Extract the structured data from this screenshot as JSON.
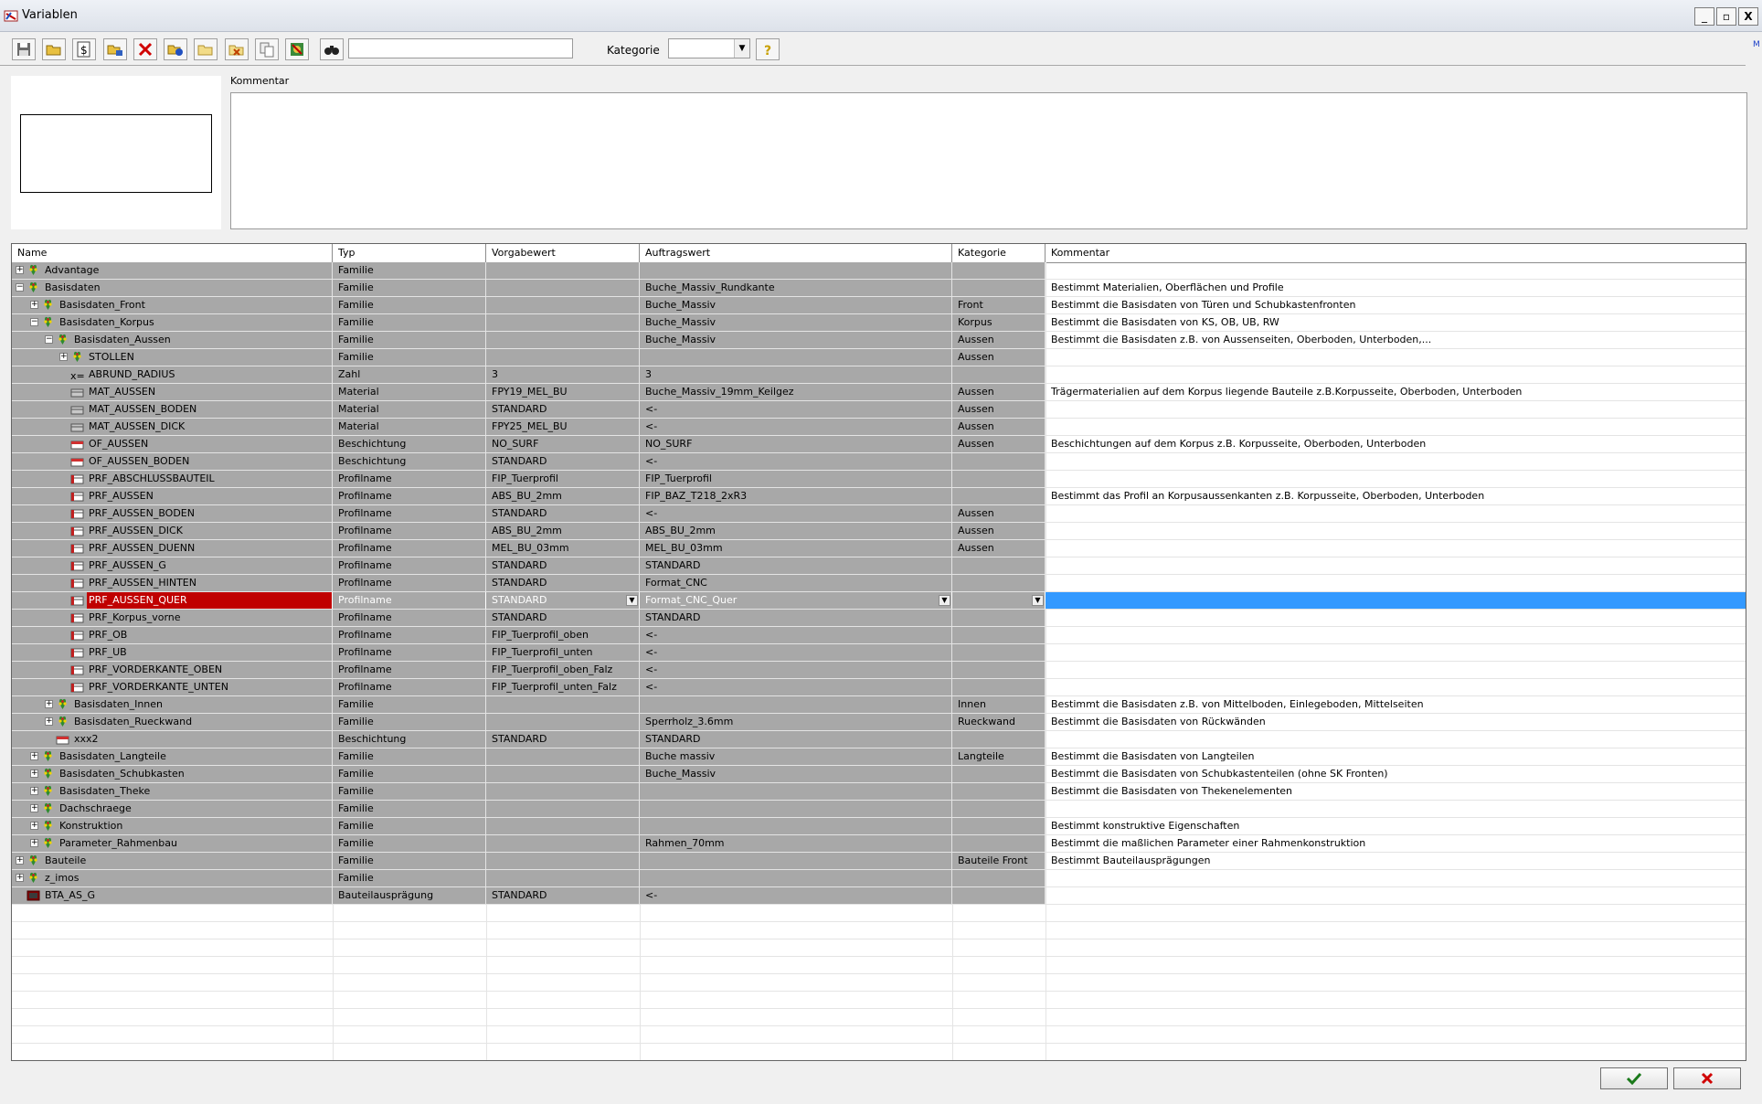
{
  "window": {
    "title": "Variablen",
    "minimize": "_",
    "maximize": "▫",
    "close": "X"
  },
  "toolbar": {
    "buttons": [
      "save-icon",
      "open-folder-icon",
      "dollar-icon",
      "tree-edit-icon",
      "delete-icon",
      "add-variable-icon",
      "folder-icon",
      "cut-icon",
      "copy-icon",
      "export-icon",
      "binoculars-icon"
    ],
    "search_value": "",
    "kategorie_label": "Kategorie",
    "kategorie_value": "",
    "help_icon": "help-icon",
    "edge_link": "M"
  },
  "top_panel": {
    "comment_label": "Kommentar",
    "comment_value": ""
  },
  "table": {
    "columns": [
      "Name",
      "Typ",
      "Vorgabewert",
      "Auftragswert",
      "Kategorie",
      "Kommentar"
    ],
    "rows": [
      {
        "level": 0,
        "exp": "+",
        "icon": "family",
        "name": "Advantage",
        "typ": "Familie",
        "vorgabe": "",
        "auftrag": "",
        "kat": "",
        "komm": ""
      },
      {
        "level": 0,
        "exp": "-",
        "icon": "family",
        "name": "Basisdaten",
        "typ": "Familie",
        "vorgabe": "",
        "auftrag": "Buche_Massiv_Rundkante",
        "kat": "",
        "komm": "Bestimmt Materialien, Oberflächen und Profile"
      },
      {
        "level": 1,
        "exp": "+",
        "icon": "family",
        "name": "Basisdaten_Front",
        "typ": "Familie",
        "vorgabe": "",
        "auftrag": "Buche_Massiv",
        "kat": "Front",
        "komm": "Bestimmt die Basisdaten von Türen und Schubkastenfronten"
      },
      {
        "level": 1,
        "exp": "-",
        "icon": "family",
        "name": "Basisdaten_Korpus",
        "typ": "Familie",
        "vorgabe": "",
        "auftrag": "Buche_Massiv",
        "kat": "Korpus",
        "komm": "Bestimmt die Basisdaten von KS, OB, UB, RW"
      },
      {
        "level": 2,
        "exp": "-",
        "icon": "family",
        "name": "Basisdaten_Aussen",
        "typ": "Familie",
        "vorgabe": "",
        "auftrag": "Buche_Massiv",
        "kat": "Aussen",
        "komm": "Bestimmt die Basisdaten z.B. von Aussenseiten, Oberboden, Unterboden,..."
      },
      {
        "level": 3,
        "exp": "+",
        "icon": "family",
        "name": "STOLLEN",
        "typ": "Familie",
        "vorgabe": "",
        "auftrag": "",
        "kat": "Aussen",
        "komm": ""
      },
      {
        "level": 3,
        "exp": "",
        "icon": "number",
        "name": "ABRUND_RADIUS",
        "typ": "Zahl",
        "vorgabe": "3",
        "auftrag": "3",
        "kat": "",
        "komm": ""
      },
      {
        "level": 3,
        "exp": "",
        "icon": "material",
        "name": "MAT_AUSSEN",
        "typ": "Material",
        "vorgabe": "FPY19_MEL_BU",
        "auftrag": "Buche_Massiv_19mm_Keilgez",
        "kat": "Aussen",
        "komm": "Trägermaterialien auf dem Korpus liegende Bauteile z.B.Korpusseite, Oberboden, Unterboden"
      },
      {
        "level": 3,
        "exp": "",
        "icon": "material",
        "name": "MAT_AUSSEN_BODEN",
        "typ": "Material",
        "vorgabe": "STANDARD",
        "auftrag": "<-",
        "kat": "Aussen",
        "komm": ""
      },
      {
        "level": 3,
        "exp": "",
        "icon": "material",
        "name": "MAT_AUSSEN_DICK",
        "typ": "Material",
        "vorgabe": "FPY25_MEL_BU",
        "auftrag": "<-",
        "kat": "Aussen",
        "komm": ""
      },
      {
        "level": 3,
        "exp": "",
        "icon": "coating",
        "name": "OF_AUSSEN",
        "typ": "Beschichtung",
        "vorgabe": "NO_SURF",
        "auftrag": "NO_SURF",
        "kat": "Aussen",
        "komm": "Beschichtungen auf dem Korpus z.B. Korpusseite, Oberboden, Unterboden"
      },
      {
        "level": 3,
        "exp": "",
        "icon": "coating",
        "name": "OF_AUSSEN_BODEN",
        "typ": "Beschichtung",
        "vorgabe": "STANDARD",
        "auftrag": "<-",
        "kat": "",
        "komm": ""
      },
      {
        "level": 3,
        "exp": "",
        "icon": "profile",
        "name": "PRF_ABSCHLUSSBAUTEIL",
        "typ": "Profilname",
        "vorgabe": "FIP_Tuerprofil",
        "auftrag": "FIP_Tuerprofil",
        "kat": "",
        "komm": ""
      },
      {
        "level": 3,
        "exp": "",
        "icon": "profile",
        "name": "PRF_AUSSEN",
        "typ": "Profilname",
        "vorgabe": "ABS_BU_2mm",
        "auftrag": "FIP_BAZ_T218_2xR3",
        "kat": "",
        "komm": "Bestimmt das Profil an Korpusaussenkanten z.B. Korpusseite, Oberboden, Unterboden"
      },
      {
        "level": 3,
        "exp": "",
        "icon": "profile",
        "name": "PRF_AUSSEN_BODEN",
        "typ": "Profilname",
        "vorgabe": "STANDARD",
        "auftrag": "<-",
        "kat": "Aussen",
        "komm": ""
      },
      {
        "level": 3,
        "exp": "",
        "icon": "profile",
        "name": "PRF_AUSSEN_DICK",
        "typ": "Profilname",
        "vorgabe": "ABS_BU_2mm",
        "auftrag": "ABS_BU_2mm",
        "kat": "Aussen",
        "komm": ""
      },
      {
        "level": 3,
        "exp": "",
        "icon": "profile",
        "name": "PRF_AUSSEN_DUENN",
        "typ": "Profilname",
        "vorgabe": "MEL_BU_03mm",
        "auftrag": "MEL_BU_03mm",
        "kat": "Aussen",
        "komm": ""
      },
      {
        "level": 3,
        "exp": "",
        "icon": "profile",
        "name": "PRF_AUSSEN_G",
        "typ": "Profilname",
        "vorgabe": "STANDARD",
        "auftrag": "STANDARD",
        "kat": "",
        "komm": ""
      },
      {
        "level": 3,
        "exp": "",
        "icon": "profile",
        "name": "PRF_AUSSEN_HINTEN",
        "typ": "Profilname",
        "vorgabe": "STANDARD",
        "auftrag": "Format_CNC",
        "kat": "",
        "komm": ""
      },
      {
        "level": 3,
        "exp": "",
        "icon": "profile",
        "name": "PRF_AUSSEN_QUER",
        "typ": "Profilname",
        "vorgabe": "STANDARD",
        "auftrag": "Format_CNC_Quer",
        "kat": "",
        "komm": "",
        "selected": true
      },
      {
        "level": 3,
        "exp": "",
        "icon": "profile",
        "name": "PRF_Korpus_vorne",
        "typ": "Profilname",
        "vorgabe": "STANDARD",
        "auftrag": "STANDARD",
        "kat": "",
        "komm": ""
      },
      {
        "level": 3,
        "exp": "",
        "icon": "profile",
        "name": "PRF_OB",
        "typ": "Profilname",
        "vorgabe": "FIP_Tuerprofil_oben",
        "auftrag": "<-",
        "kat": "",
        "komm": ""
      },
      {
        "level": 3,
        "exp": "",
        "icon": "profile",
        "name": "PRF_UB",
        "typ": "Profilname",
        "vorgabe": "FIP_Tuerprofil_unten",
        "auftrag": "<-",
        "kat": "",
        "komm": ""
      },
      {
        "level": 3,
        "exp": "",
        "icon": "profile",
        "name": "PRF_VORDERKANTE_OBEN",
        "typ": "Profilname",
        "vorgabe": "FIP_Tuerprofil_oben_Falz",
        "auftrag": "<-",
        "kat": "",
        "komm": ""
      },
      {
        "level": 3,
        "exp": "",
        "icon": "profile",
        "name": "PRF_VORDERKANTE_UNTEN",
        "typ": "Profilname",
        "vorgabe": "FIP_Tuerprofil_unten_Falz",
        "auftrag": "<-",
        "kat": "",
        "komm": ""
      },
      {
        "level": 2,
        "exp": "+",
        "icon": "family",
        "name": "Basisdaten_Innen",
        "typ": "Familie",
        "vorgabe": "",
        "auftrag": "",
        "kat": "Innen",
        "komm": "Bestimmt die Basisdaten z.B. von Mittelboden, Einlegeboden, Mittelseiten"
      },
      {
        "level": 2,
        "exp": "+",
        "icon": "family",
        "name": "Basisdaten_Rueckwand",
        "typ": "Familie",
        "vorgabe": "",
        "auftrag": "Sperrholz_3.6mm",
        "kat": "Rueckwand",
        "komm": "Bestimmt die Basisdaten von Rückwänden"
      },
      {
        "level": 2,
        "exp": "",
        "icon": "coating",
        "name": "xxx2",
        "typ": "Beschichtung",
        "vorgabe": "STANDARD",
        "auftrag": "STANDARD",
        "kat": "",
        "komm": ""
      },
      {
        "level": 1,
        "exp": "+",
        "icon": "family",
        "name": "Basisdaten_Langteile",
        "typ": "Familie",
        "vorgabe": "",
        "auftrag": "Buche massiv",
        "kat": "Langteile",
        "komm": "Bestimmt die Basisdaten von Langteilen"
      },
      {
        "level": 1,
        "exp": "+",
        "icon": "family",
        "name": "Basisdaten_Schubkasten",
        "typ": "Familie",
        "vorgabe": "",
        "auftrag": "Buche_Massiv",
        "kat": "",
        "komm": "Bestimmt die Basisdaten von Schubkastenteilen (ohne SK Fronten)"
      },
      {
        "level": 1,
        "exp": "+",
        "icon": "family",
        "name": "Basisdaten_Theke",
        "typ": "Familie",
        "vorgabe": "",
        "auftrag": "",
        "kat": "",
        "komm": "Bestimmt die Basisdaten von Thekenelementen"
      },
      {
        "level": 1,
        "exp": "+",
        "icon": "family",
        "name": "Dachschraege",
        "typ": "Familie",
        "vorgabe": "",
        "auftrag": "",
        "kat": "",
        "komm": ""
      },
      {
        "level": 1,
        "exp": "+",
        "icon": "family",
        "name": "Konstruktion",
        "typ": "Familie",
        "vorgabe": "",
        "auftrag": "",
        "kat": "",
        "komm": "Bestimmt konstruktive Eigenschaften"
      },
      {
        "level": 1,
        "exp": "+",
        "icon": "family",
        "name": "Parameter_Rahmenbau",
        "typ": "Familie",
        "vorgabe": "",
        "auftrag": "Rahmen_70mm",
        "kat": "",
        "komm": "Bestimmt die maßlichen Parameter einer Rahmenkonstruktion"
      },
      {
        "level": 0,
        "exp": "+",
        "icon": "family",
        "name": "Bauteile",
        "typ": "Familie",
        "vorgabe": "",
        "auftrag": "",
        "kat": "Bauteile Front",
        "komm": "Bestimmt Bauteilausprägungen"
      },
      {
        "level": 0,
        "exp": "+",
        "icon": "family",
        "name": "z_imos",
        "typ": "Familie",
        "vorgabe": "",
        "auftrag": "",
        "kat": "",
        "komm": ""
      },
      {
        "level": 0,
        "exp": "",
        "icon": "part",
        "name": "BTA_AS_G",
        "typ": "Bauteilausprägung",
        "vorgabe": "STANDARD",
        "auftrag": "<-",
        "kat": "",
        "komm": ""
      }
    ]
  },
  "footer": {
    "ok_icon": "checkmark-icon",
    "cancel_icon": "red-x-icon"
  }
}
